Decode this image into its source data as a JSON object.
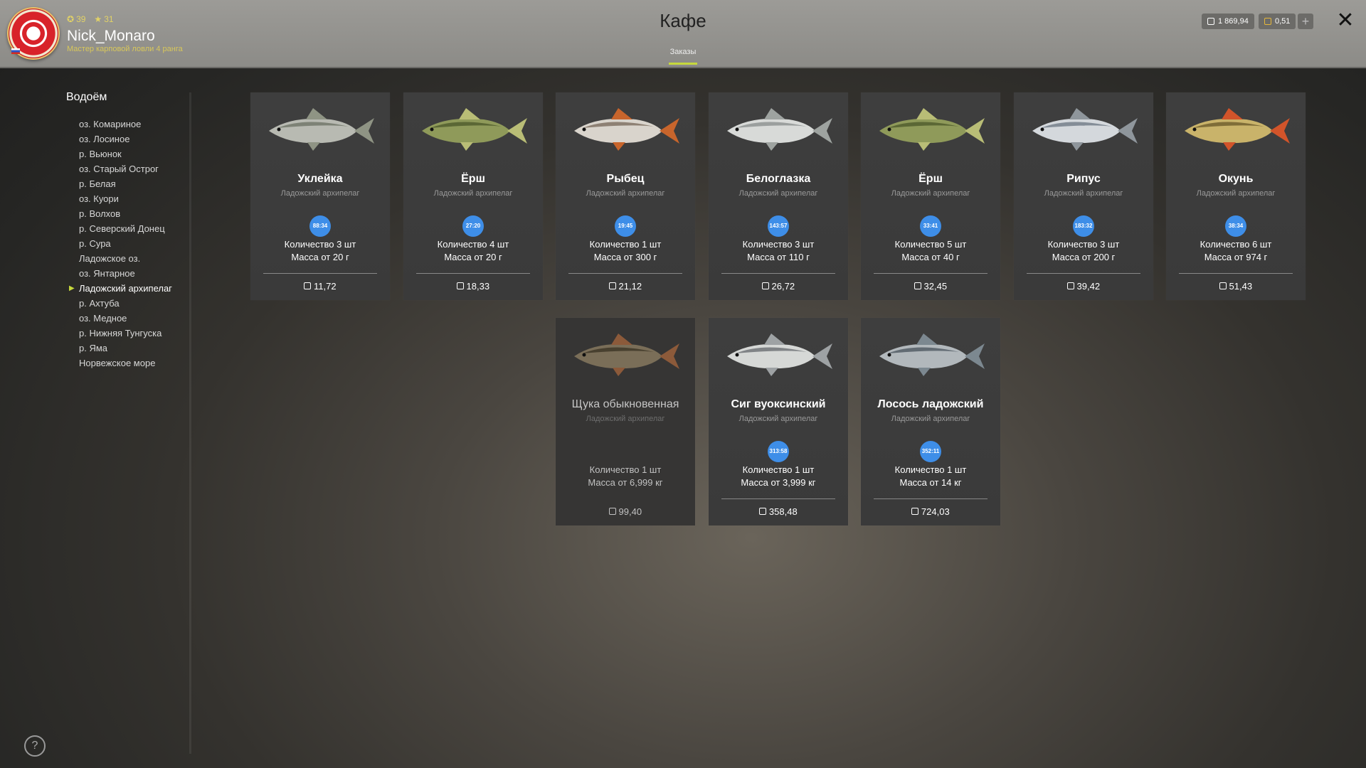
{
  "header": {
    "title": "Кафе",
    "tab_label": "Заказы",
    "level": "39",
    "stars": "31",
    "username": "Nick_Monaro",
    "rank": "Мастер карповой ловли 4 ранга",
    "silver": "1 869,94",
    "gold": "0,51",
    "plus": "+",
    "close": "✕"
  },
  "sidebar": {
    "title": "Водоём",
    "items": [
      "оз. Комариное",
      "оз. Лосиное",
      "р. Вьюнок",
      "оз. Старый Острог",
      "р. Белая",
      "оз. Куори",
      "р. Волхов",
      "р. Северский Донец",
      "р. Сура",
      "Ладожское оз.",
      "оз. Янтарное",
      "Ладожский архипелаг",
      "р. Ахтуба",
      "оз. Медное",
      "р. Нижняя Тунгуска",
      "р. Яма",
      "Норвежское море"
    ],
    "active_index": 11
  },
  "cards": [
    {
      "name": "Уклейка",
      "location": "Ладожский архипелаг",
      "timer": "88:34",
      "qty": "Количество 3 шт",
      "mass": "Масса от 20 г",
      "price": "11,72"
    },
    {
      "name": "Ёрш",
      "location": "Ладожский архипелаг",
      "timer": "27:20",
      "qty": "Количество 4 шт",
      "mass": "Масса от 20 г",
      "price": "18,33"
    },
    {
      "name": "Рыбец",
      "location": "Ладожский архипелаг",
      "timer": "19:45",
      "qty": "Количество 1 шт",
      "mass": "Масса от 300 г",
      "price": "21,12"
    },
    {
      "name": "Белоглазка",
      "location": "Ладожский архипелаг",
      "timer": "143:57",
      "qty": "Количество 3 шт",
      "mass": "Масса от 110 г",
      "price": "26,72"
    },
    {
      "name": "Ёрш",
      "location": "Ладожский архипелаг",
      "timer": "33:41",
      "qty": "Количество 5 шт",
      "mass": "Масса от 40 г",
      "price": "32,45"
    },
    {
      "name": "Рипус",
      "location": "Ладожский архипелаг",
      "timer": "183:32",
      "qty": "Количество 3 шт",
      "mass": "Масса от 200 г",
      "price": "39,42"
    },
    {
      "name": "Окунь",
      "location": "Ладожский архипелаг",
      "timer": "38:34",
      "qty": "Количество 6 шт",
      "mass": "Масса от 974 г",
      "price": "51,43"
    },
    {
      "name": "Щука обыкновенная",
      "location": "Ладожский архипелаг",
      "timer": "",
      "qty": "Количество 1 шт",
      "mass": "Масса от 6,999 кг",
      "price": "99,40"
    },
    {
      "name": "Сиг вуоксинский",
      "location": "Ладожский архипелаг",
      "timer": "313:58",
      "qty": "Количество 1 шт",
      "mass": "Масса от 3,999 кг",
      "price": "358,48"
    },
    {
      "name": "Лосось ладожский",
      "location": "Ладожский архипелаг",
      "timer": "352:11",
      "qty": "Количество 1 шт",
      "mass": "Масса от 14 кг",
      "price": "724,03"
    }
  ],
  "help": "?"
}
